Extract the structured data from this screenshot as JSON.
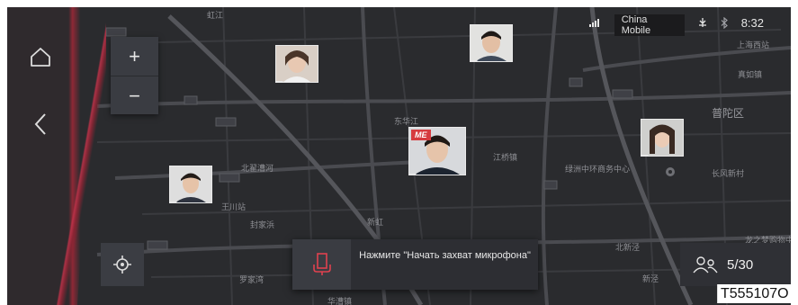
{
  "status_bar": {
    "signal_icon": "signal-bars-icon",
    "carrier_line1": "China",
    "carrier_line2": "Mobile",
    "usb_icon": "usb-icon",
    "bluetooth_icon": "bluetooth-icon",
    "time": "8:32"
  },
  "nav": {
    "home_icon": "home-icon",
    "back_icon": "chevron-left-icon"
  },
  "zoom": {
    "in_label": "+",
    "out_label": "−"
  },
  "locate_icon": "crosshair-icon",
  "avatars": [
    {
      "id": "user-1"
    },
    {
      "id": "user-2"
    },
    {
      "id": "me",
      "badge": "ME"
    },
    {
      "id": "user-4"
    },
    {
      "id": "user-5"
    }
  ],
  "voice": {
    "mic_icon": "microphone-icon",
    "prompt": "Нажмите \"Начать захват микрофона\""
  },
  "participants": {
    "icon": "people-icon",
    "count": "5/30"
  },
  "watermark": "T555107O",
  "map_labels": {
    "district1": "普陀区",
    "poi1": "绿洲中环商务中心",
    "area1": "长风新村",
    "area2": "江桥镇",
    "area3": "王川站",
    "area4": "北翟路",
    "area5": "新泾",
    "area6": "龙之梦购物中心",
    "area7": "上海西站",
    "area8": "真如镇",
    "area9": "北新泾",
    "area10": "华漕镇",
    "area11": "罗家湾",
    "area12": "封家浜"
  },
  "colors": {
    "map_bg": "#2a2b2e",
    "accent_red": "#c2334a",
    "me_badge": "#d63b3f",
    "panel": "#3a3c42"
  }
}
